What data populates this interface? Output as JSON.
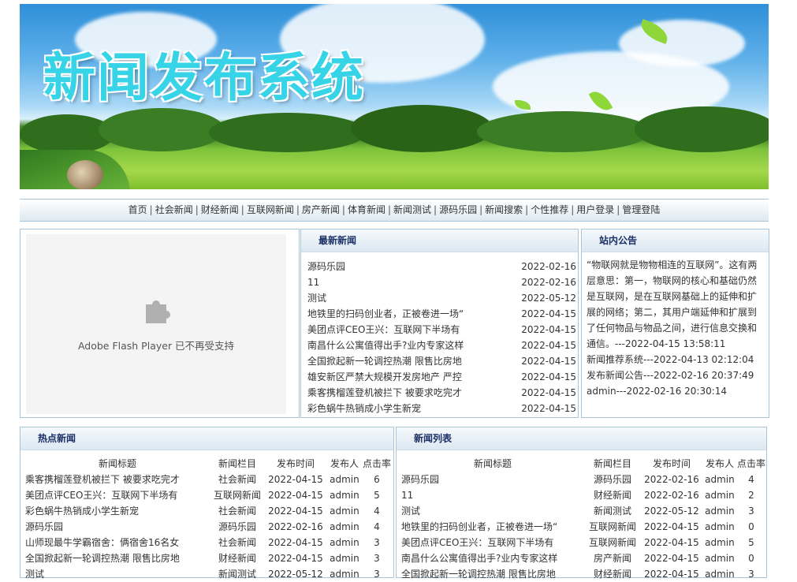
{
  "banner": {
    "title": "新闻发布系统"
  },
  "nav": [
    "首页",
    "社会新闻",
    "财经新闻",
    "互联网新闻",
    "房产新闻",
    "体育新闻",
    "新闻测试",
    "源码乐园",
    "新闻搜索",
    "个性推荐",
    "用户登录",
    "管理登陆"
  ],
  "flash": {
    "message": "Adobe Flash Player 已不再受支持"
  },
  "latest": {
    "title": "最新新闻",
    "items": [
      {
        "title": "源码乐园",
        "date": "2022-02-16"
      },
      {
        "title": "11",
        "date": "2022-02-16"
      },
      {
        "title": "测试",
        "date": "2022-05-12"
      },
      {
        "title": "地铁里的扫码创业者，正被卷进一场“",
        "date": "2022-04-15"
      },
      {
        "title": "美团点评CEO王兴：互联网下半场有",
        "date": "2022-04-15"
      },
      {
        "title": "南昌什么公寓值得出手?业内专家这样",
        "date": "2022-04-15"
      },
      {
        "title": "全国掀起新一轮调控热潮 限售比房地",
        "date": "2022-04-15"
      },
      {
        "title": "雄安新区严禁大规模开发房地产 严控",
        "date": "2022-04-15"
      },
      {
        "title": "乘客携榴莲登机被拦下 被要求吃完才",
        "date": "2022-04-15"
      },
      {
        "title": "彩色蜗牛热销成小学生新宠",
        "date": "2022-04-15"
      }
    ]
  },
  "notice": {
    "title": "站内公告",
    "text": "“物联网就是物物相连的互联网”。这有两层意思：第一，物联网的核心和基础仍然是互联网，是在互联网基础上的延伸和扩展的网络；第二，其用户端延伸和扩展到了任何物品与物品之间，进行信息交换和通信。---2022-04-15 13:58:11",
    "lines": [
      "新闻推荐系统---2022-04-13 02:12:04",
      "发布新闻公告---2022-02-16 20:37:49",
      "admin---2022-02-16 20:30:14"
    ]
  },
  "hot": {
    "title": "热点新闻",
    "columns": [
      "新闻标题",
      "新闻栏目",
      "发布时间",
      "发布人",
      "点击率"
    ],
    "rows": [
      [
        "乘客携榴莲登机被拦下 被要求吃完才",
        "社会新闻",
        "2022-04-15",
        "admin",
        "6"
      ],
      [
        "美团点评CEO王兴：互联网下半场有",
        "互联网新闻",
        "2022-04-15",
        "admin",
        "5"
      ],
      [
        "彩色蜗牛热销成小学生新宠",
        "社会新闻",
        "2022-04-15",
        "admin",
        "4"
      ],
      [
        "源码乐园",
        "源码乐园",
        "2022-02-16",
        "admin",
        "4"
      ],
      [
        "山师现最牛学霸宿舍：俩宿舍16名女",
        "社会新闻",
        "2022-04-15",
        "admin",
        "3"
      ],
      [
        "全国掀起新一轮调控热潮 限售比房地",
        "财经新闻",
        "2022-04-15",
        "admin",
        "3"
      ],
      [
        "测试",
        "新闻测试",
        "2022-05-12",
        "admin",
        "3"
      ]
    ]
  },
  "list": {
    "title": "新闻列表",
    "columns": [
      "新闻标题",
      "新闻栏目",
      "发布时间",
      "发布人",
      "点击率"
    ],
    "rows": [
      [
        "源码乐园",
        "源码乐园",
        "2022-02-16",
        "admin",
        "4"
      ],
      [
        "11",
        "财经新闻",
        "2022-02-16",
        "admin",
        "2"
      ],
      [
        "测试",
        "新闻测试",
        "2022-05-12",
        "admin",
        "3"
      ],
      [
        "地铁里的扫码创业者，正被卷进一场“",
        "互联网新闻",
        "2022-04-15",
        "admin",
        "0"
      ],
      [
        "美团点评CEO王兴：互联网下半场有",
        "互联网新闻",
        "2022-04-15",
        "admin",
        "5"
      ],
      [
        "南昌什么公寓值得出手?业内专家这样",
        "房产新闻",
        "2022-04-15",
        "admin",
        "0"
      ],
      [
        "全国掀起新一轮调控热潮 限售比房地",
        "财经新闻",
        "2022-04-15",
        "admin",
        "3"
      ]
    ]
  }
}
